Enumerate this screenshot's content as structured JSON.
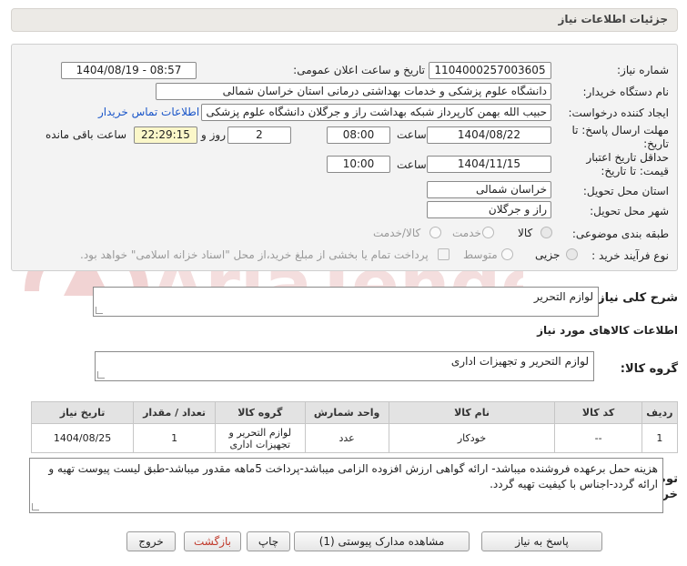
{
  "title": "جزئیات اطلاعات نیاز",
  "form": {
    "need_number_label": "شماره نیاز:",
    "need_number": "1104000257003605",
    "announce_label": "تاریخ و ساعت اعلان عمومی:",
    "announce_value": "1404/08/19 - 08:57",
    "buyer_org_label": "نام دستگاه خریدار:",
    "buyer_org": "دانشگاه علوم پزشکی و خدمات بهداشتی درمانی استان خراسان شمالی",
    "creator_label": "ایجاد کننده درخواست:",
    "creator": "حبیب الله بهمن کارپرداز شبکه بهداشت راز و جرگلان دانشگاه علوم پزشکی و خد",
    "contact_link": "اطلاعات تماس خریدار",
    "reply_deadline_label": "مهلت ارسال پاسخ: تا تاریخ:",
    "reply_date": "1404/08/22",
    "time_label": "ساعت",
    "reply_time": "08:00",
    "days": "2",
    "days_label": "روز و",
    "remaining": "22:29:15",
    "remaining_label": "ساعت باقی مانده",
    "validity_label": "حداقل تاریخ اعتبار قیمت: تا تاریخ:",
    "validity_date": "1404/11/15",
    "validity_time": "10:00",
    "province_label": "استان محل تحویل:",
    "province": "خراسان شمالی",
    "city_label": "شهر محل تحویل:",
    "city": "راز و جرگلان",
    "category_label": "طبقه بندی موضوعی:",
    "category_options": [
      "کالا",
      "خدمت",
      "کالا/خدمت"
    ],
    "process_label": "نوع فرآیند خرید :",
    "process_options": [
      "جزیی",
      "متوسط"
    ],
    "process_note": "پرداخت تمام یا بخشی از مبلغ خرید،از محل \"اسناد خزانه اسلامی\" خواهد بود."
  },
  "summary": {
    "label": "شرح کلی نیاز:",
    "value": "لوازم التحریر"
  },
  "goods_info_title": "اطلاعات کالاهای مورد نیاز",
  "goods_group": {
    "label": "گروه کالا:",
    "value": "لوازم التحریر و تجهیزات اداری"
  },
  "table": {
    "headers": [
      "ردیف",
      "کد کالا",
      "نام کالا",
      "واحد شمارش",
      "گروه کالا",
      "تعداد / مقدار",
      "تاریخ نیاز"
    ],
    "rows": [
      [
        "1",
        "--",
        "خودکار",
        "عدد",
        "لوازم التحریر و تجهیزات اداری",
        "1",
        "1404/08/25"
      ]
    ]
  },
  "buyer_notes": {
    "label": "توضیحات خریدار:",
    "value": "هزینه حمل برعهده فروشنده میباشد- ارائه گواهی ارزش افزوده الزامی میباشد-پرداخت 5ماهه مقدور میباشد-طبق لیست پیوست تهیه و ارائه گردد-اجناس با کیفیت تهیه گردد."
  },
  "buttons": {
    "reply": "پاسخ به نیاز",
    "docs": "مشاهده مدارک پیوستی (1)",
    "print": "چاپ",
    "back": "بازگشت",
    "exit": "خروج"
  },
  "watermark": "AriaTender.neT",
  "colors": {
    "link": "#1a56c9",
    "highlight": "#fbf7c9",
    "watermark": "#f2dada"
  }
}
